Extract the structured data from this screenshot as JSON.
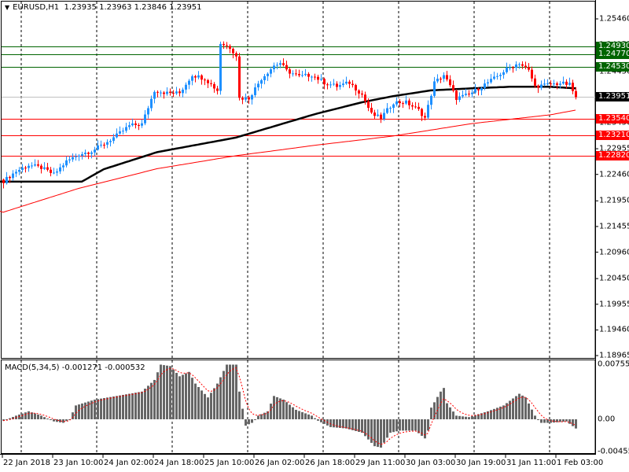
{
  "header": {
    "symbol": "EURUSD,H1",
    "open": "1.23935",
    "high": "1.23963",
    "low": "1.23846",
    "close": "1.23951"
  },
  "macd": {
    "label": "MACD(5,34,5)",
    "main": "-0.001271",
    "signal": "-0.000532",
    "axis_labels": [
      "0.007554",
      "0.00",
      "-0.004555"
    ]
  },
  "colors": {
    "bull": "#1E90FF",
    "bear": "#FF0000",
    "resistance": "#006400",
    "support": "#FF0000",
    "current": "#000000",
    "ma_fast": "#000000",
    "ma_slow": "#FF0000",
    "histogram": "#666666"
  },
  "price_axis": {
    "labels": [
      "1.25460",
      "1.24955",
      "1.24450",
      "1.23950",
      "1.23450",
      "1.22955",
      "1.22460",
      "1.21950",
      "1.21455",
      "1.20960",
      "1.20450",
      "1.19955",
      "1.19460",
      "1.18965"
    ]
  },
  "levels": [
    {
      "price": "1.24930",
      "kind": "resistance"
    },
    {
      "price": "1.24770",
      "kind": "resistance"
    },
    {
      "price": "1.24530",
      "kind": "resistance"
    },
    {
      "price": "1.23951",
      "kind": "current"
    },
    {
      "price": "1.23540",
      "kind": "support"
    },
    {
      "price": "1.23210",
      "kind": "support"
    },
    {
      "price": "1.22820",
      "kind": "support"
    }
  ],
  "time_axis": {
    "labels": [
      "22 Jan 2018",
      "23 Jan 10:00",
      "24 Jan 02:00",
      "24 Jan 18:00",
      "25 Jan 10:00",
      "26 Jan 02:00",
      "26 Jan 18:00",
      "29 Jan 11:00",
      "30 Jan 03:00",
      "30 Jan 19:00",
      "31 Jan 11:00",
      "1 Feb 03:00"
    ]
  },
  "chart_data": {
    "type": "candlestick",
    "symbol": "EURUSD",
    "timeframe": "H1",
    "bars": 183,
    "ylim": [
      1.18965,
      1.2546
    ],
    "close_path": [
      [
        0,
        1.2233
      ],
      [
        4,
        1.2252
      ],
      [
        8,
        1.2264
      ],
      [
        12,
        1.2259
      ],
      [
        16,
        1.2246
      ],
      [
        20,
        1.2271
      ],
      [
        24,
        1.2285
      ],
      [
        28,
        1.2291
      ],
      [
        32,
        1.2305
      ],
      [
        36,
        1.2321
      ],
      [
        40,
        1.234
      ],
      [
        44,
        1.2343
      ],
      [
        48,
        1.2408
      ],
      [
        52,
        1.2403
      ],
      [
        56,
        1.2403
      ],
      [
        60,
        1.2438
      ],
      [
        64,
        1.2431
      ],
      [
        68,
        1.2408
      ],
      [
        69,
        1.2499
      ],
      [
        72,
        1.2491
      ],
      [
        74,
        1.2476
      ],
      [
        75,
        1.2393
      ],
      [
        78,
        1.2393
      ],
      [
        82,
        1.2431
      ],
      [
        86,
        1.2456
      ],
      [
        88,
        1.2461
      ],
      [
        90,
        1.2446
      ],
      [
        94,
        1.2435
      ],
      [
        98,
        1.2438
      ],
      [
        102,
        1.2423
      ],
      [
        106,
        1.2416
      ],
      [
        110,
        1.2423
      ],
      [
        114,
        1.24
      ],
      [
        117,
        1.2362
      ],
      [
        120,
        1.2355
      ],
      [
        124,
        1.2385
      ],
      [
        128,
        1.2385
      ],
      [
        132,
        1.237
      ],
      [
        134,
        1.2355
      ],
      [
        137,
        1.2423
      ],
      [
        140,
        1.2438
      ],
      [
        142,
        1.2416
      ],
      [
        144,
        1.2393
      ],
      [
        148,
        1.24
      ],
      [
        152,
        1.2416
      ],
      [
        156,
        1.2431
      ],
      [
        160,
        1.2449
      ],
      [
        164,
        1.2461
      ],
      [
        167,
        1.2446
      ],
      [
        169,
        1.2416
      ],
      [
        173,
        1.2419
      ],
      [
        177,
        1.2422
      ],
      [
        180,
        1.2419
      ],
      [
        182,
        1.2395
      ]
    ],
    "ma_fast_path": [
      [
        0,
        1.2232
      ],
      [
        25,
        1.2232
      ],
      [
        32,
        1.2256
      ],
      [
        49,
        1.2289
      ],
      [
        74,
        1.2317
      ],
      [
        99,
        1.2362
      ],
      [
        114,
        1.2385
      ],
      [
        124,
        1.2397
      ],
      [
        136,
        1.2408
      ],
      [
        149,
        1.2412
      ],
      [
        161,
        1.2415
      ],
      [
        174,
        1.2415
      ],
      [
        182,
        1.2412
      ]
    ],
    "ma_slow_path": [
      [
        0,
        1.2173
      ],
      [
        24,
        1.2219
      ],
      [
        49,
        1.2257
      ],
      [
        74,
        1.2282
      ],
      [
        99,
        1.2302
      ],
      [
        124,
        1.232
      ],
      [
        149,
        1.2344
      ],
      [
        174,
        1.2361
      ],
      [
        182,
        1.237
      ]
    ],
    "macd_path": [
      [
        0,
        -0.0002
      ],
      [
        4,
        0.0005
      ],
      [
        8,
        0.0011
      ],
      [
        12,
        0.0005
      ],
      [
        16,
        -0.0003
      ],
      [
        19,
        -0.0005
      ],
      [
        21,
        0
      ],
      [
        23,
        0.0019
      ],
      [
        29,
        0.0027
      ],
      [
        36,
        0.0032
      ],
      [
        44,
        0.0038
      ],
      [
        48,
        0.0054
      ],
      [
        50,
        0.0075
      ],
      [
        53,
        0.0073
      ],
      [
        56,
        0.0059
      ],
      [
        59,
        0.0065
      ],
      [
        61,
        0.0049
      ],
      [
        65,
        0.003
      ],
      [
        68,
        0.0049
      ],
      [
        71,
        0.0075
      ],
      [
        74,
        0.0075
      ],
      [
        75,
        0.0038
      ],
      [
        77,
        -0.0009
      ],
      [
        79,
        -0.0005
      ],
      [
        81,
        0.0005
      ],
      [
        84,
        0.0011
      ],
      [
        86,
        0.0032
      ],
      [
        89,
        0.0027
      ],
      [
        93,
        0.0013
      ],
      [
        98,
        0.0005
      ],
      [
        100,
        -0.0002
      ],
      [
        104,
        -0.0011
      ],
      [
        109,
        -0.0013
      ],
      [
        114,
        -0.0019
      ],
      [
        118,
        -0.0038
      ],
      [
        120,
        -0.004
      ],
      [
        123,
        -0.0019
      ],
      [
        126,
        -0.0016
      ],
      [
        131,
        -0.0016
      ],
      [
        134,
        -0.0027
      ],
      [
        135,
        -0.0016
      ],
      [
        136,
        0.0016
      ],
      [
        139,
        0.0038
      ],
      [
        140,
        0.0043
      ],
      [
        141,
        0.0022
      ],
      [
        144,
        0.0005
      ],
      [
        148,
        0.0003
      ],
      [
        154,
        0.0011
      ],
      [
        159,
        0.0019
      ],
      [
        164,
        0.0035
      ],
      [
        166,
        0.003
      ],
      [
        169,
        0.0005
      ],
      [
        171,
        -0.0005
      ],
      [
        174,
        -0.0005
      ],
      [
        179,
        -0.0003
      ],
      [
        182,
        -0.0013
      ]
    ],
    "macd_ylim": [
      -0.004555,
      0.007554
    ]
  }
}
